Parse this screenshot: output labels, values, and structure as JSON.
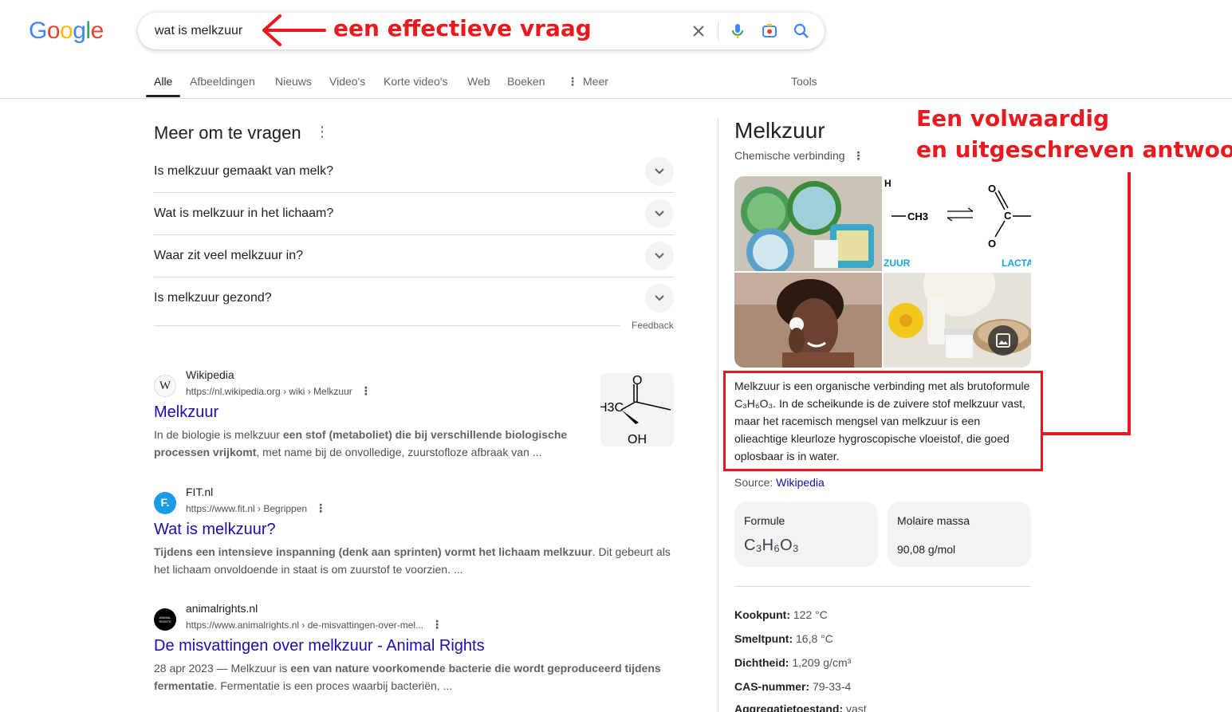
{
  "logo": {
    "letters": [
      "G",
      "o",
      "o",
      "g",
      "l",
      "e"
    ],
    "colors": [
      "#4285f4",
      "#ea4335",
      "#fbbc05",
      "#4285f4",
      "#34a853",
      "#ea4335"
    ]
  },
  "search": {
    "query": "wat is melkzuur"
  },
  "annotations": {
    "top": "een effectieve vraag",
    "right_line1": "Een volwaardig",
    "right_line2": "en uitgeschreven antwoord",
    "accent": "#e8191f"
  },
  "tabs": {
    "items": [
      "Alle",
      "Afbeeldingen",
      "Nieuws",
      "Video's",
      "Korte video's",
      "Web",
      "Boeken",
      "Meer"
    ],
    "tools": "Tools"
  },
  "paa": {
    "title": "Meer om te vragen",
    "questions": [
      "Is melkzuur gemaakt van melk?",
      "Wat is melkzuur in het lichaam?",
      "Waar zit veel melkzuur in?",
      "Is melkzuur gezond?"
    ],
    "feedback": "Feedback"
  },
  "results": [
    {
      "favicon": "W",
      "site": "Wikipedia",
      "url": "https://nl.wikipedia.org › wiki › Melkzuur",
      "title": "Melkzuur",
      "snippet_1": "In de biologie is melkzuur ",
      "snippet_b1": "een stof (metaboliet) die bij verschillende biologische processen vrijkomt",
      "snippet_2": ", met name bij de onvolledige, zuurstofloze afbraak van ...",
      "thumb_texts": {
        "o": "O",
        "h3c": "H3C",
        "oh": "OH"
      }
    },
    {
      "favicon": "F.",
      "site": "FIT.nl",
      "url": "https://www.fit.nl › Begrippen",
      "title": "Wat is melkzuur?",
      "snippet_b1": "Tijdens een intensieve inspanning (denk aan sprinten) vormt het lichaam melkzuur",
      "snippet_2": ". Dit gebeurt als het lichaam onvoldoende in staat is om zuurstof te voorzien. ..."
    },
    {
      "favicon": "ANIMAL RIGHTS",
      "site": "animalrights.nl",
      "url": "https://www.animalrights.nl › de-misvattingen-over-mel...",
      "title": "De misvattingen over melkzuur - Animal Rights",
      "snippet_1": "28 apr 2023 — Melkzuur is ",
      "snippet_b1": "een van nature voorkomende bacterie die wordt geproduceerd tijdens fermentatie",
      "snippet_2": ". Fermentatie is een proces waarbij bacteriën, ..."
    }
  ],
  "knowledge_panel": {
    "title": "Melkzuur",
    "subtitle": "Chemische verbinding",
    "gallery_labels": {
      "h": "H",
      "ch3": "CH3",
      "o_top": "O",
      "c": "C",
      "o_bottom": "O",
      "zuur": "ZUUR",
      "lacta": "LACTA"
    },
    "description": "Melkzuur is een organische verbinding met als brutoformule C₃H₆O₃. In de scheikunde is de zuivere stof melkzuur vast, maar het racemisch mengsel van melkzuur is een olieachtige kleurloze hygroscopische vloeistof, die goed oplosbaar is in water.",
    "source_label": "Source:",
    "source_link": "Wikipedia",
    "cards": [
      {
        "label": "Formule",
        "value": "C₃H₆O₃"
      },
      {
        "label": "Molaire massa",
        "value": "90,08 g/mol"
      }
    ],
    "facts": [
      {
        "label": "Kookpunt:",
        "value": "122 °C"
      },
      {
        "label": "Smeltpunt:",
        "value": "16,8 °C"
      },
      {
        "label": "Dichtheid:",
        "value": "1,209 g/cm³"
      },
      {
        "label": "CAS-nummer:",
        "value": "79-33-4"
      },
      {
        "label": "Aggregatietoestand:",
        "value": "vast"
      }
    ]
  }
}
